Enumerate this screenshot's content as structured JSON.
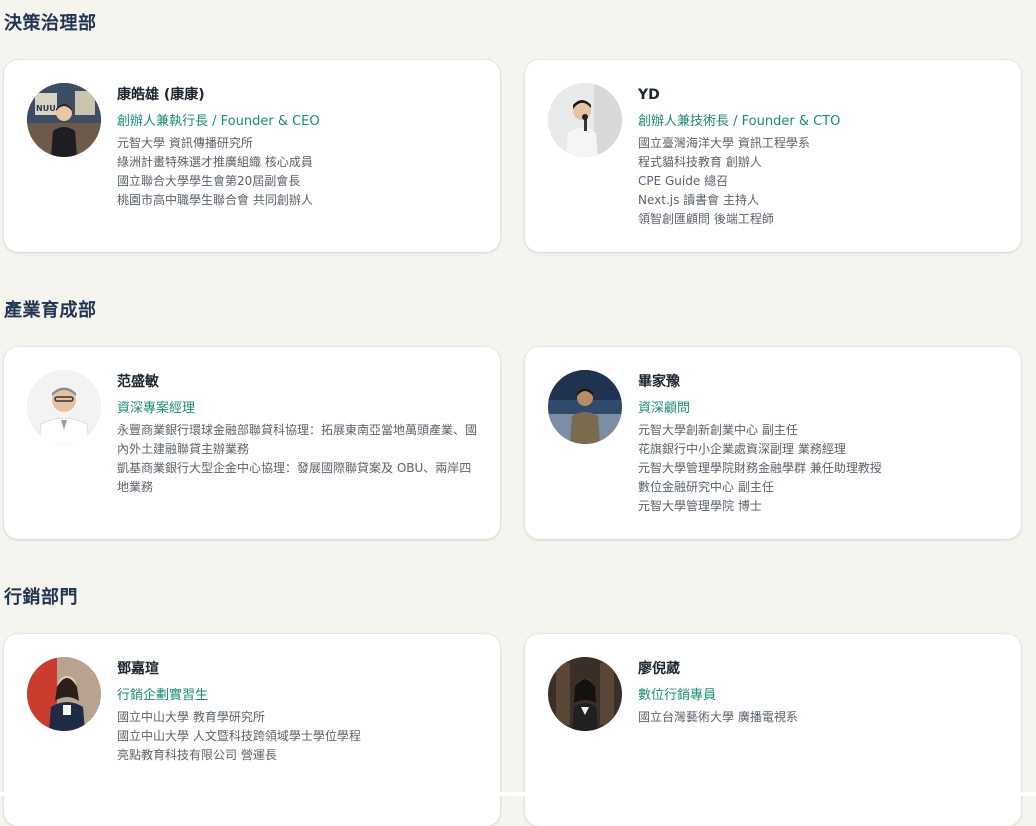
{
  "sections": [
    {
      "title": "決策治理部",
      "members": [
        {
          "name": "康皓雄 (康康)",
          "role": "創辦人兼執行長 / Founder & CEO",
          "bio": [
            "元智大學 資訊傳播研究所",
            "綠洲計畫特殊選才推廣組織 核心成員",
            "國立聯合大學學生會第20屆副會長",
            "桃園市高中職學生聯合會 共同創辦人"
          ],
          "avatar_text": "NUU"
        },
        {
          "name": "YD",
          "role": "創辦人兼技術長 / Founder & CTO",
          "bio": [
            "國立臺灣海洋大學 資訊工程學系",
            "程式貓科技教育 創辦人",
            "CPE Guide 總召",
            "Next.js 讀書會 主持人",
            "領智創匯顧問 後端工程師"
          ]
        }
      ]
    },
    {
      "title": "產業育成部",
      "members": [
        {
          "name": "范盛敏",
          "role": "資深專案經理",
          "bio": [
            "永豐商業銀行環球金融部聯貸科協理：拓展東南亞當地萬頭產業、國內外土建融聯貸主辦業務",
            "凱基商業銀行大型企金中心協理：發展國際聯貸案及 OBU、兩岸四地業務"
          ]
        },
        {
          "name": "畢家豫",
          "role": "資深顧問",
          "bio": [
            "元智大學創新創業中心 副主任",
            "花旗銀行中小企業處資深副理 業務經理",
            "元智大學管理學院財務金融學群 兼任助理教授",
            "數位金融研究中心 副主任",
            "元智大學管理學院 博士"
          ]
        }
      ]
    },
    {
      "title": "行銷部門",
      "members": [
        {
          "name": "鄧嘉瑄",
          "role": "行銷企劃實習生",
          "bio": [
            "國立中山大學 教育學研究所",
            "國立中山大學 人文暨科技跨領域學士學位學程",
            "亮點教育科技有限公司 營運長"
          ]
        },
        {
          "name": "廖倪葳",
          "role": "數位行銷專員",
          "bio": [
            "國立台灣藝術大學 廣播電視系"
          ]
        }
      ]
    }
  ]
}
